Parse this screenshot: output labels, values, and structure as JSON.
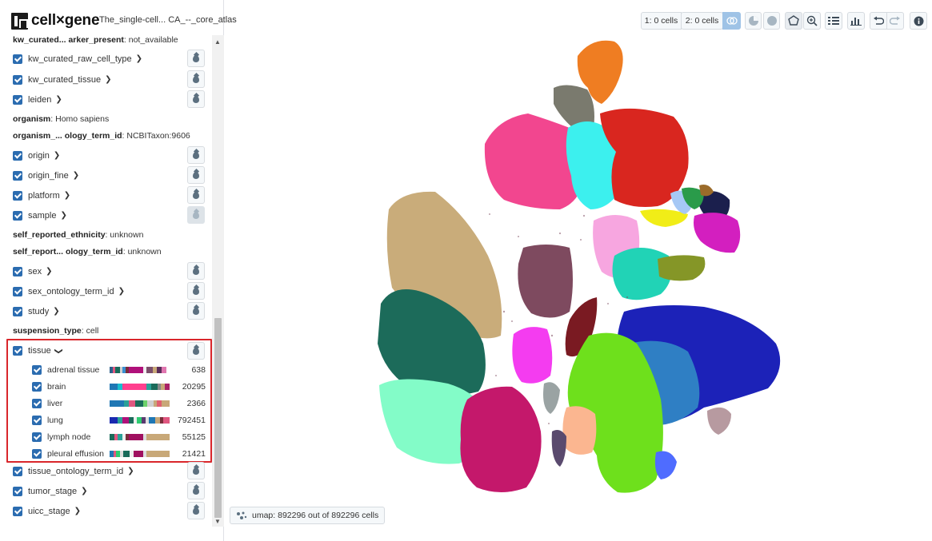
{
  "app": {
    "title": "cell×gene",
    "dataset_title": "The_single-cell... CA_--_core_atlas"
  },
  "categories": [
    {
      "type": "meta",
      "key": "kw_curated... arker_present",
      "value": "not_available"
    },
    {
      "type": "cat",
      "label": "kw_curated_raw_cell_type"
    },
    {
      "type": "cat",
      "label": "kw_curated_tissue"
    },
    {
      "type": "cat",
      "label": "leiden"
    },
    {
      "type": "meta",
      "key": "organism",
      "value": "Homo sapiens"
    },
    {
      "type": "meta",
      "key": "organism_... ology_term_id",
      "value": "NCBITaxon:9606"
    },
    {
      "type": "cat",
      "label": "origin"
    },
    {
      "type": "cat",
      "label": "origin_fine"
    },
    {
      "type": "cat",
      "label": "platform"
    },
    {
      "type": "cat",
      "label": "sample"
    },
    {
      "type": "meta",
      "key": "self_reported_ethnicity",
      "value": "unknown"
    },
    {
      "type": "meta",
      "key": "self_report... ology_term_id",
      "value": "unknown"
    },
    {
      "type": "cat",
      "label": "sex"
    },
    {
      "type": "cat",
      "label": "sex_ontology_term_id"
    },
    {
      "type": "cat",
      "label": "study"
    },
    {
      "type": "meta",
      "key": "suspension_type",
      "value": "cell"
    }
  ],
  "tissue": {
    "label": "tissue",
    "values": [
      {
        "label": "adrenal tissue",
        "count": "638"
      },
      {
        "label": "brain",
        "count": "20295"
      },
      {
        "label": "liver",
        "count": "2366"
      },
      {
        "label": "lung",
        "count": "792451"
      },
      {
        "label": "lymph node",
        "count": "55125"
      },
      {
        "label": "pleural effusion",
        "count": "21421"
      }
    ]
  },
  "categories_after": [
    {
      "label": "tissue_ontology_term_id"
    },
    {
      "label": "tumor_stage"
    },
    {
      "label": "uicc_stage"
    }
  ],
  "toolbar": {
    "selection1": "1: 0 cells",
    "selection2": "2: 0 cells"
  },
  "embedding": {
    "label": "umap: 892296 out of 892296 cells"
  },
  "colors": {
    "accent": "#2b6cb0",
    "highlight_border": "#d9262b"
  }
}
